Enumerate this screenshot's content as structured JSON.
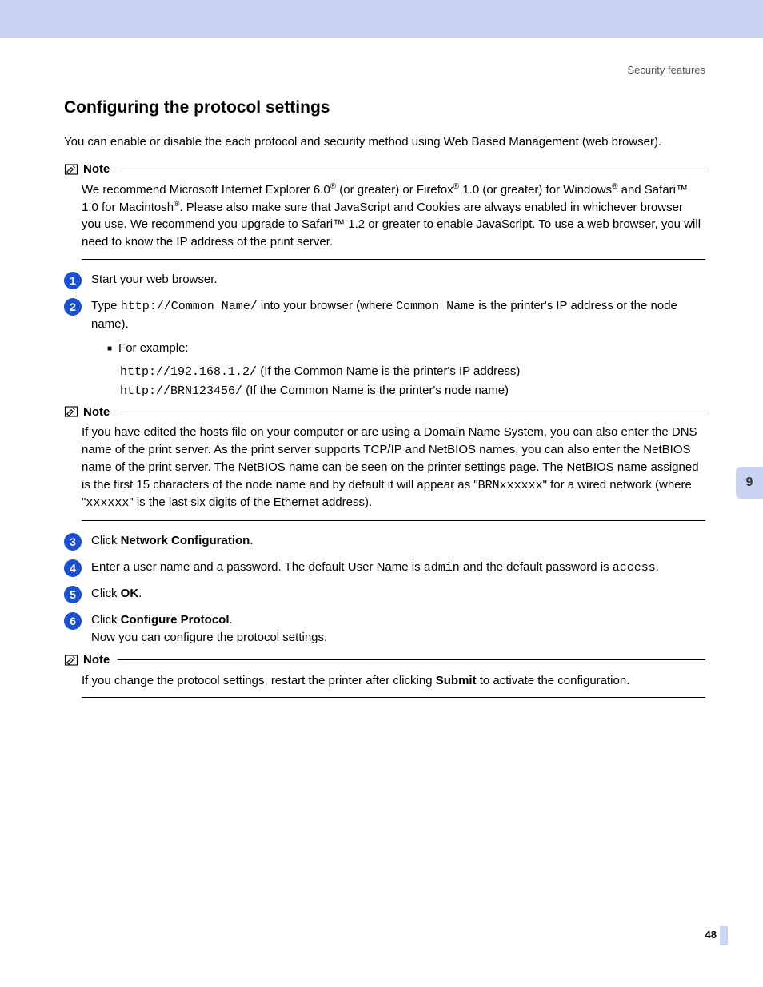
{
  "header": {
    "right": "Security features"
  },
  "title": "Configuring the protocol settings",
  "intro": "You can enable or disable the each protocol and security method using Web Based Management (web browser).",
  "noteLabel": "Note",
  "note1": {
    "p1a": "We recommend Microsoft Internet Explorer 6.0",
    "p1b": " (or greater) or Firefox",
    "p1c": " 1.0 (or greater) for Windows",
    "p1d": " and Safari™ 1.0 for Macintosh",
    "p1e": ". Please also make sure that JavaScript and Cookies are always enabled in whichever browser you use. We recommend you upgrade to Safari™ 1.2 or greater to enable JavaScript. To use a web browser, you will need to know the IP address of the print server."
  },
  "step1": "Start your web browser.",
  "step2a": "Type ",
  "step2code": "http://Common Name/",
  "step2b": " into your browser (where ",
  "step2code2": "Common Name",
  "step2c": " is the printer's IP address or the node name).",
  "example_label": "For example:",
  "ex1code": "http://192.168.1.2/",
  "ex1txt": "  (If the Common Name is the printer's IP address)",
  "ex2code": "http://BRN123456/",
  "ex2txt": "  (If the Common Name is the printer's node name)",
  "note2a": "If you have edited the hosts file on your computer or are using a Domain Name System, you can also enter the DNS name of the print server. As the print server supports TCP/IP and NetBIOS names, you can also enter the NetBIOS name of the print server. The NetBIOS name can be seen on the printer settings page. The NetBIOS name assigned is the first 15 characters of the node name and by default it will appear as \"",
  "note2code1": "BRNxxxxxx",
  "note2b": "\" for a wired network (where \"",
  "note2code2": "xxxxxx",
  "note2c": "\" is the last six digits of the Ethernet address).",
  "step3a": "Click ",
  "step3b": "Network Configuration",
  "step3c": ".",
  "step4a": "Enter a user name and a password. The default User Name is ",
  "step4code1": "admin",
  "step4b": " and the default password is ",
  "step4code2": "access",
  "step4c": ".",
  "step5a": "Click ",
  "step5b": "OK",
  "step5c": ".",
  "step6a": "Click ",
  "step6b": "Configure Protocol",
  "step6c": ".",
  "step6d": "Now you can configure the protocol settings.",
  "note3a": "If you change the protocol settings, restart the printer after clicking ",
  "note3b": "Submit",
  "note3c": " to activate the configuration.",
  "sidetab": "9",
  "pagenum": "48"
}
